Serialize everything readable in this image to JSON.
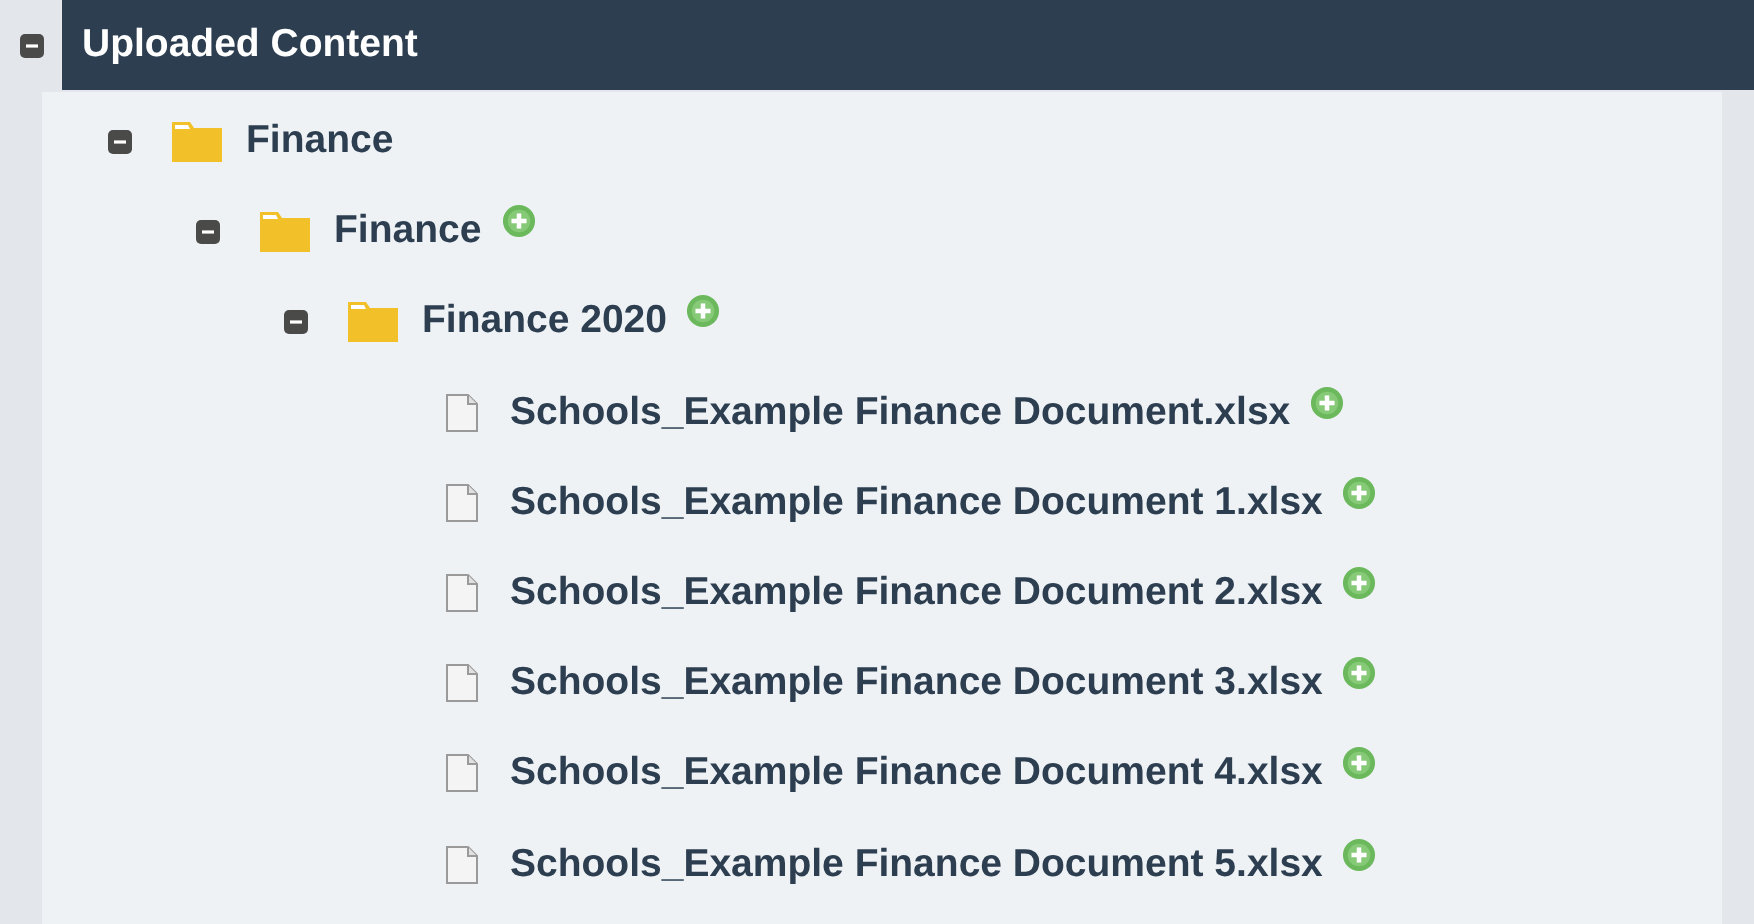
{
  "tree": {
    "label": "Uploaded Content",
    "expanded": true,
    "children": [
      {
        "kind": "folder",
        "label": "Finance",
        "expanded": true,
        "addable": false,
        "children": [
          {
            "kind": "folder",
            "label": "Finance",
            "expanded": true,
            "addable": true,
            "children": [
              {
                "kind": "folder",
                "label": "Finance 2020",
                "expanded": true,
                "addable": true,
                "children": [
                  {
                    "kind": "file",
                    "label": "Schools_Example Finance Document.xlsx",
                    "addable": true
                  },
                  {
                    "kind": "file",
                    "label": "Schools_Example Finance Document 1.xlsx",
                    "addable": true
                  },
                  {
                    "kind": "file",
                    "label": "Schools_Example Finance Document 2.xlsx",
                    "addable": true
                  },
                  {
                    "kind": "file",
                    "label": "Schools_Example Finance Document 3.xlsx",
                    "addable": true
                  },
                  {
                    "kind": "file",
                    "label": "Schools_Example Finance Document 4.xlsx",
                    "addable": true
                  },
                  {
                    "kind": "file",
                    "label": "Schools_Example Finance Document 5.xlsx",
                    "addable": true
                  }
                ]
              }
            ]
          }
        ]
      }
    ]
  }
}
